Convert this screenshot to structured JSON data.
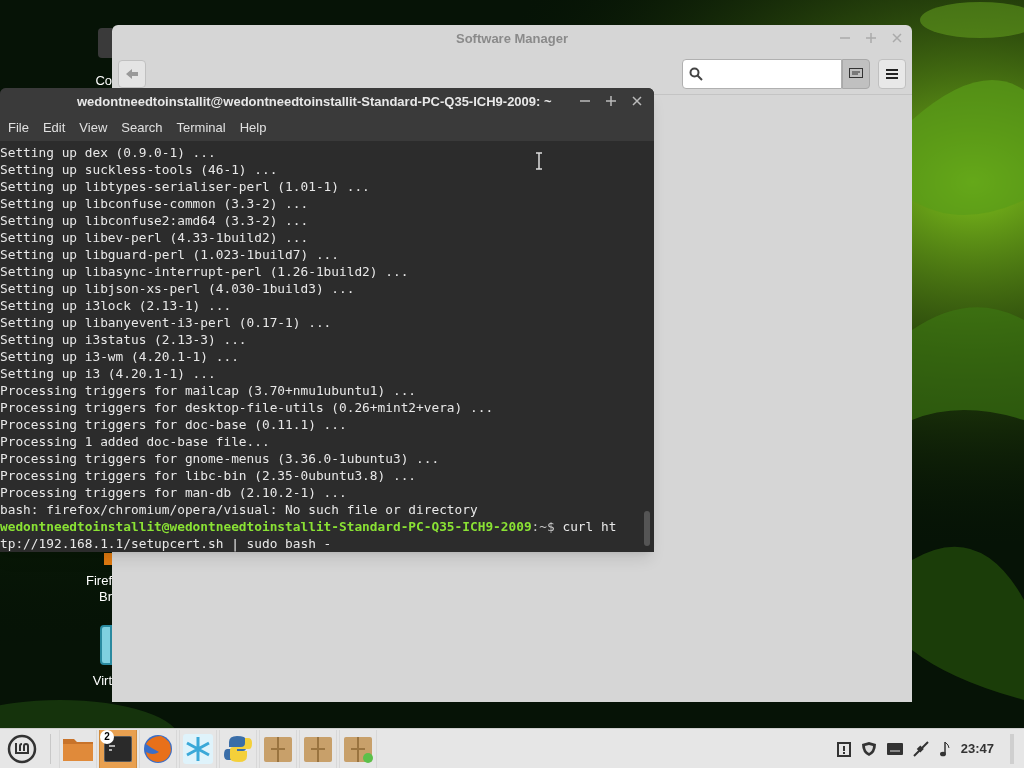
{
  "desktop_icons": [
    {
      "kind": "computer",
      "labels": [
        "Co"
      ]
    },
    {
      "kind": "browser",
      "labels": [
        "Firef",
        "Br"
      ]
    },
    {
      "kind": "vm",
      "labels": [
        "Virt"
      ]
    }
  ],
  "software_manager": {
    "title": "Software Manager"
  },
  "terminal": {
    "title": "wedontneedtoinstallit@wedontneedtoinstallit-Standard-PC-Q35-ICH9-2009: ~",
    "menu": [
      "File",
      "Edit",
      "View",
      "Search",
      "Terminal",
      "Help"
    ],
    "lines": [
      {
        "kind": "output",
        "text": "Setting up dex (0.9.0-1) ..."
      },
      {
        "kind": "output",
        "text": "Setting up suckless-tools (46-1) ..."
      },
      {
        "kind": "output",
        "text": "Setting up libtypes-serialiser-perl (1.01-1) ..."
      },
      {
        "kind": "output",
        "text": "Setting up libconfuse-common (3.3-2) ..."
      },
      {
        "kind": "output",
        "text": "Setting up libconfuse2:amd64 (3.3-2) ..."
      },
      {
        "kind": "output",
        "text": "Setting up libev-perl (4.33-1build2) ..."
      },
      {
        "kind": "output",
        "text": "Setting up libguard-perl (1.023-1build7) ..."
      },
      {
        "kind": "output",
        "text": "Setting up libasync-interrupt-perl (1.26-1build2) ..."
      },
      {
        "kind": "output",
        "text": "Setting up libjson-xs-perl (4.030-1build3) ..."
      },
      {
        "kind": "output",
        "text": "Setting up i3lock (2.13-1) ..."
      },
      {
        "kind": "output",
        "text": "Setting up libanyevent-i3-perl (0.17-1) ..."
      },
      {
        "kind": "output",
        "text": "Setting up i3status (2.13-3) ..."
      },
      {
        "kind": "output",
        "text": "Setting up i3-wm (4.20.1-1) ..."
      },
      {
        "kind": "output",
        "text": "Setting up i3 (4.20.1-1) ..."
      },
      {
        "kind": "output",
        "text": "Processing triggers for mailcap (3.70+nmu1ubuntu1) ..."
      },
      {
        "kind": "output",
        "text": "Processing triggers for desktop-file-utils (0.26+mint2+vera) ..."
      },
      {
        "kind": "output",
        "text": "Processing triggers for doc-base (0.11.1) ..."
      },
      {
        "kind": "output",
        "text": "Processing 1 added doc-base file..."
      },
      {
        "kind": "output",
        "text": "Processing triggers for gnome-menus (3.36.0-1ubuntu3) ..."
      },
      {
        "kind": "output",
        "text": "Processing triggers for libc-bin (2.35-0ubuntu3.8) ..."
      },
      {
        "kind": "output",
        "text": "Processing triggers for man-db (2.10.2-1) ..."
      },
      {
        "kind": "output",
        "text": "bash: firefox/chromium/opera/visual: No such file or directory"
      },
      {
        "kind": "prompt",
        "user_host": "wedontneedtoinstallit@wedontneedtoinstallit-Standard-PC-Q35-ICH9-2009",
        "path": ":~$",
        "command": "curl ht"
      },
      {
        "kind": "output",
        "text": "tp://192.168.1.1/setupcert.sh | sudo bash -"
      }
    ]
  },
  "taskbar": {
    "apps": [
      {
        "kind": "folder",
        "selected": false
      },
      {
        "kind": "terminal",
        "selected": true,
        "badge": "2"
      },
      {
        "kind": "firefox",
        "selected": false
      },
      {
        "kind": "snowflake",
        "selected": false
      },
      {
        "kind": "python",
        "selected": false
      },
      {
        "kind": "package",
        "selected": false
      },
      {
        "kind": "package",
        "selected": false
      },
      {
        "kind": "package_update",
        "selected": false
      }
    ],
    "clock": "23:47"
  }
}
